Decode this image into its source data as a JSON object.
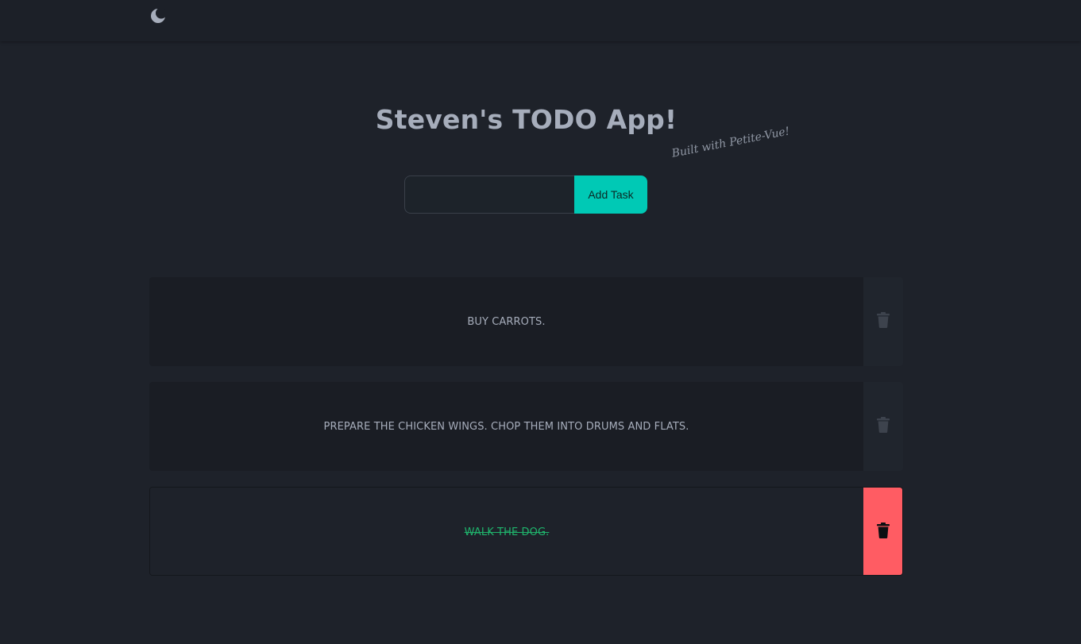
{
  "header": {
    "theme_icon": "moon-icon"
  },
  "main": {
    "title": "Steven's TODO App!",
    "tagline": "Built with Petite-Vue!",
    "form": {
      "input_value": "",
      "input_placeholder": "",
      "add_button_label": "Add Task"
    }
  },
  "tasks": [
    {
      "text": "Buy carrots.",
      "done": false,
      "delete_icon": "trash-icon"
    },
    {
      "text": "Prepare the chicken wings. Chop them into drums and flats.",
      "done": false,
      "delete_icon": "trash-icon"
    },
    {
      "text": "Walk the dog.",
      "done": true,
      "delete_icon": "trash-icon"
    }
  ],
  "colors": {
    "background": "#1e222a",
    "accent": "#00c9b5",
    "done_text": "#1fb46c",
    "delete_active": "#ff5c63",
    "text": "#a6adbb"
  }
}
